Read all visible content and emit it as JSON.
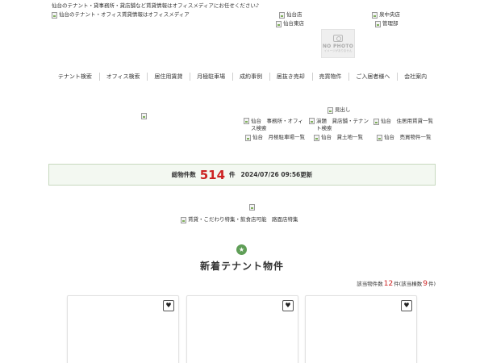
{
  "header": {
    "tagline": "仙台のテナント・貸事務所・貸店舗など賃貸情報はオフィスメディアにお任せください♪",
    "logo_alt": "仙台のテナント・オフィス賃貸情報はオフィスメディア",
    "branches": [
      "仙台店",
      "泉中央店",
      "仙台東店",
      "管理部"
    ],
    "no_photo": {
      "title": "NO PHOTO",
      "subtitle": "イメージがありません"
    }
  },
  "nav": {
    "items": [
      "テナント検索",
      "オフィス検索",
      "居住用賃貸",
      "月極駐車場",
      "成約事例",
      "居抜き売却",
      "売買物件",
      "ご入居者様へ",
      "会社案内"
    ]
  },
  "heading_img_alt": "見出し",
  "quick_links": {
    "row1": [
      "仙台　事務所・オフィス検索",
      "演題　貸店舗・テナント検索",
      "仙台　住居用賃貸一覧"
    ],
    "row2": [
      "仙台　月極駐車場一覧",
      "仙台　貸土地一覧",
      "仙台　売買物件一覧"
    ]
  },
  "stats": {
    "label": "総物件数",
    "count": "514",
    "unit": "件",
    "updated": "2024/07/26 09:56更新"
  },
  "feature_banner_alt": "賃貸・こだわり特集・飲食店可能　路面店特集",
  "new_section": {
    "icon": "star-badge-icon",
    "title": "新着テナント物件",
    "match_label": "該当物件数",
    "match_count": "12",
    "match_unit": "件(該当棟数",
    "building_count": "9",
    "building_unit": "件)"
  },
  "cards": [
    {
      "fav_icon": "heart-icon"
    },
    {
      "fav_icon": "heart-icon"
    },
    {
      "fav_icon": "heart-icon"
    }
  ],
  "colors": {
    "accent_green": "#5f9e57",
    "highlight_red": "#cc2222",
    "stats_bg": "#f3f8f1"
  }
}
